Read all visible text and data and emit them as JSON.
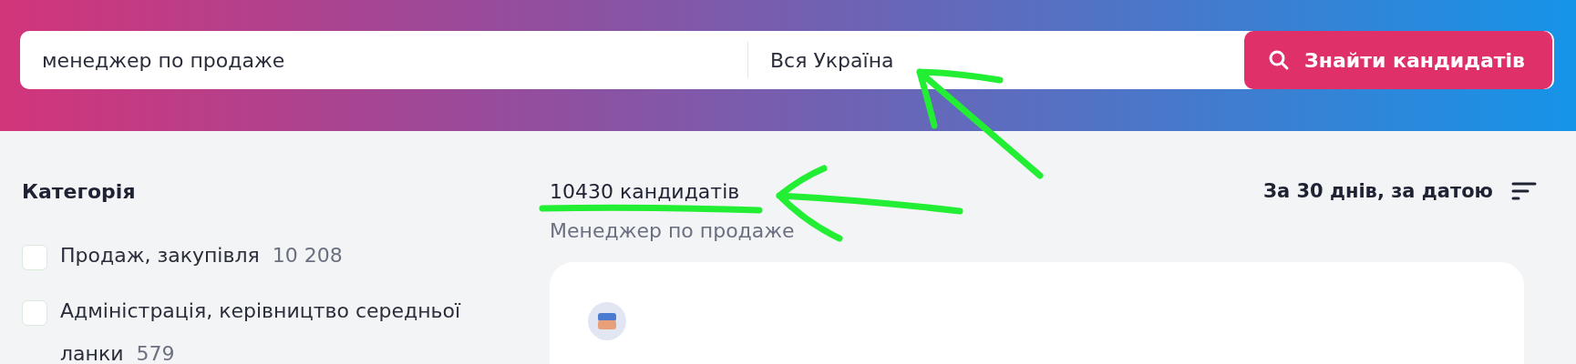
{
  "search": {
    "query": "менеджер по продаже",
    "location": "Вся Україна",
    "button": "Знайти кандидатів"
  },
  "filters": {
    "title": "Категорія",
    "items": [
      {
        "label": "Продаж, закупівля",
        "count": "10 208",
        "checked": false
      },
      {
        "label": "Адміністрація, керівництво середньої ланки",
        "count": "579",
        "checked": false
      }
    ]
  },
  "results": {
    "count": "10430 кандидатів",
    "query": "Менеджер по продаже",
    "sort": "За 30 днів, за датою"
  }
}
